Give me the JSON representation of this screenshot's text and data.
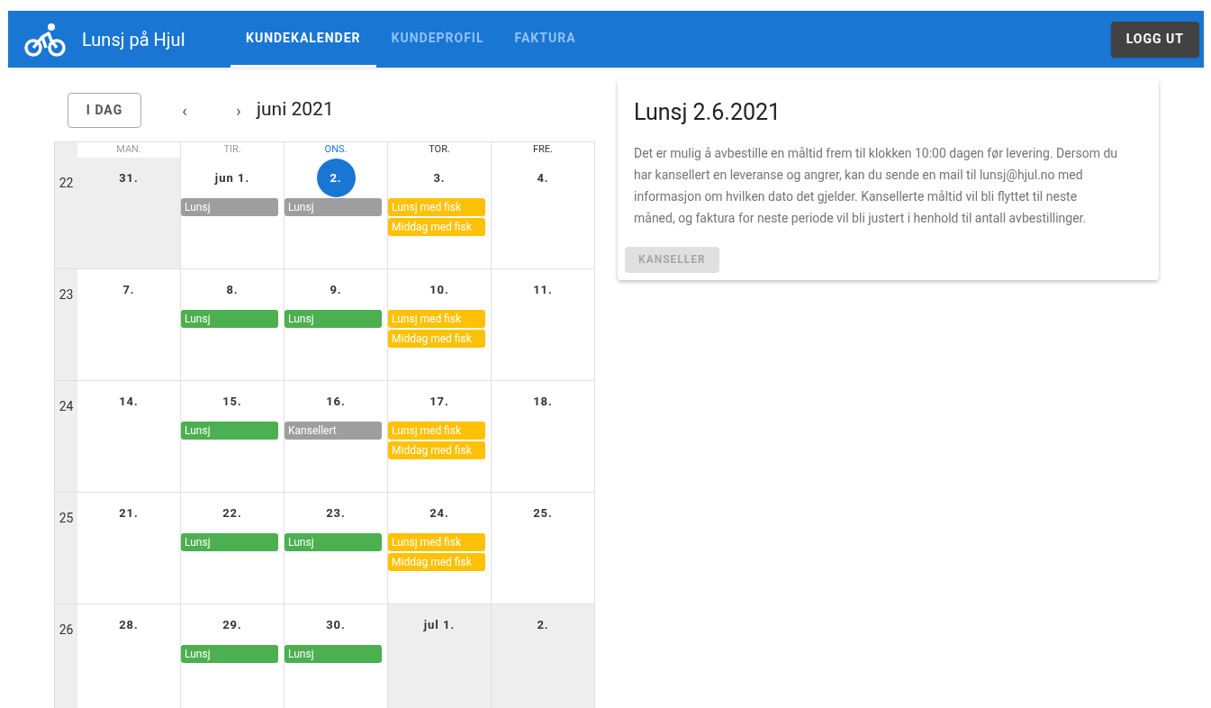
{
  "app_bar": {
    "title": "Lunsj på Hjul",
    "tabs": [
      {
        "label": "KUNDEKALENDER",
        "selected": true
      },
      {
        "label": "KUNDEPROFIL",
        "selected": false
      },
      {
        "label": "FAKTURA",
        "selected": false
      }
    ],
    "logout_button": "LOGG UT"
  },
  "toolbar": {
    "today_button": "I DAG",
    "prev": "‹",
    "next": "›",
    "month": "juni 2021"
  },
  "day_headers": [
    {
      "label": "MAN.",
      "kind": "past"
    },
    {
      "label": "TIR.",
      "kind": "past"
    },
    {
      "label": "ONS.",
      "kind": "today"
    },
    {
      "label": "TOR.",
      "kind": "future"
    },
    {
      "label": "FRE.",
      "kind": "future"
    }
  ],
  "weeks": [
    {
      "number": "22",
      "days": [
        {
          "label": "31.",
          "outside": true,
          "selected": false
        },
        {
          "label": "jun 1.",
          "outside": false,
          "selected": false,
          "events": [
            {
              "title": "Lunsj",
              "color": "#9e9e9e"
            }
          ]
        },
        {
          "label": "2.",
          "outside": false,
          "selected": true,
          "events": [
            {
              "title": "Lunsj",
              "color": "#9e9e9e"
            }
          ]
        },
        {
          "label": "3.",
          "outside": false,
          "selected": false,
          "events": [
            {
              "title": "Lunsj med fisk",
              "color": "#ffc107"
            },
            {
              "title": "Middag med fisk",
              "color": "#ffc107"
            }
          ]
        },
        {
          "label": "4.",
          "outside": false,
          "selected": false
        }
      ]
    },
    {
      "number": "23",
      "days": [
        {
          "label": "7.",
          "outside": false,
          "selected": false
        },
        {
          "label": "8.",
          "outside": false,
          "selected": false,
          "events": [
            {
              "title": "Lunsj",
              "color": "#4caf50"
            }
          ]
        },
        {
          "label": "9.",
          "outside": false,
          "selected": false,
          "events": [
            {
              "title": "Lunsj",
              "color": "#4caf50"
            }
          ]
        },
        {
          "label": "10.",
          "outside": false,
          "selected": false,
          "events": [
            {
              "title": "Lunsj med fisk",
              "color": "#ffc107"
            },
            {
              "title": "Middag med fisk",
              "color": "#ffc107"
            }
          ]
        },
        {
          "label": "11.",
          "outside": false,
          "selected": false
        }
      ]
    },
    {
      "number": "24",
      "days": [
        {
          "label": "14.",
          "outside": false,
          "selected": false
        },
        {
          "label": "15.",
          "outside": false,
          "selected": false,
          "events": [
            {
              "title": "Lunsj",
              "color": "#4caf50"
            }
          ]
        },
        {
          "label": "16.",
          "outside": false,
          "selected": false,
          "events": [
            {
              "title": "Kansellert",
              "color": "#9e9e9e"
            }
          ]
        },
        {
          "label": "17.",
          "outside": false,
          "selected": false,
          "events": [
            {
              "title": "Lunsj med fisk",
              "color": "#ffc107"
            },
            {
              "title": "Middag med fisk",
              "color": "#ffc107"
            }
          ]
        },
        {
          "label": "18.",
          "outside": false,
          "selected": false
        }
      ]
    },
    {
      "number": "25",
      "days": [
        {
          "label": "21.",
          "outside": false,
          "selected": false
        },
        {
          "label": "22.",
          "outside": false,
          "selected": false,
          "events": [
            {
              "title": "Lunsj",
              "color": "#4caf50"
            }
          ]
        },
        {
          "label": "23.",
          "outside": false,
          "selected": false,
          "events": [
            {
              "title": "Lunsj",
              "color": "#4caf50"
            }
          ]
        },
        {
          "label": "24.",
          "outside": false,
          "selected": false,
          "events": [
            {
              "title": "Lunsj med fisk",
              "color": "#ffc107"
            },
            {
              "title": "Middag med fisk",
              "color": "#ffc107"
            }
          ]
        },
        {
          "label": "25.",
          "outside": false,
          "selected": false
        }
      ]
    },
    {
      "number": "26",
      "days": [
        {
          "label": "28.",
          "outside": false,
          "selected": false
        },
        {
          "label": "29.",
          "outside": false,
          "selected": false,
          "events": [
            {
              "title": "Lunsj",
              "color": "#4caf50"
            }
          ]
        },
        {
          "label": "30.",
          "outside": false,
          "selected": false,
          "events": [
            {
              "title": "Lunsj",
              "color": "#4caf50"
            }
          ]
        },
        {
          "label": "jul 1.",
          "outside": true,
          "selected": false
        },
        {
          "label": "2.",
          "outside": true,
          "selected": false
        }
      ]
    }
  ],
  "detail": {
    "title": "Lunsj 2.6.2021",
    "text": "Det er mulig å avbestille en måltid frem til klokken 10:00 dagen før levering. Dersom du har kansellert en leveranse og angrer, kan du sende en mail til lunsj@hjul.no med informasjon om hvilken dato det gjelder. Kansellerte måltid vil bli flyttet til neste måned, og faktura for neste periode vil bli justert i henhold til antall avbestillinger.",
    "cancel_button": "KANSELLER",
    "cancel_disabled": true
  }
}
